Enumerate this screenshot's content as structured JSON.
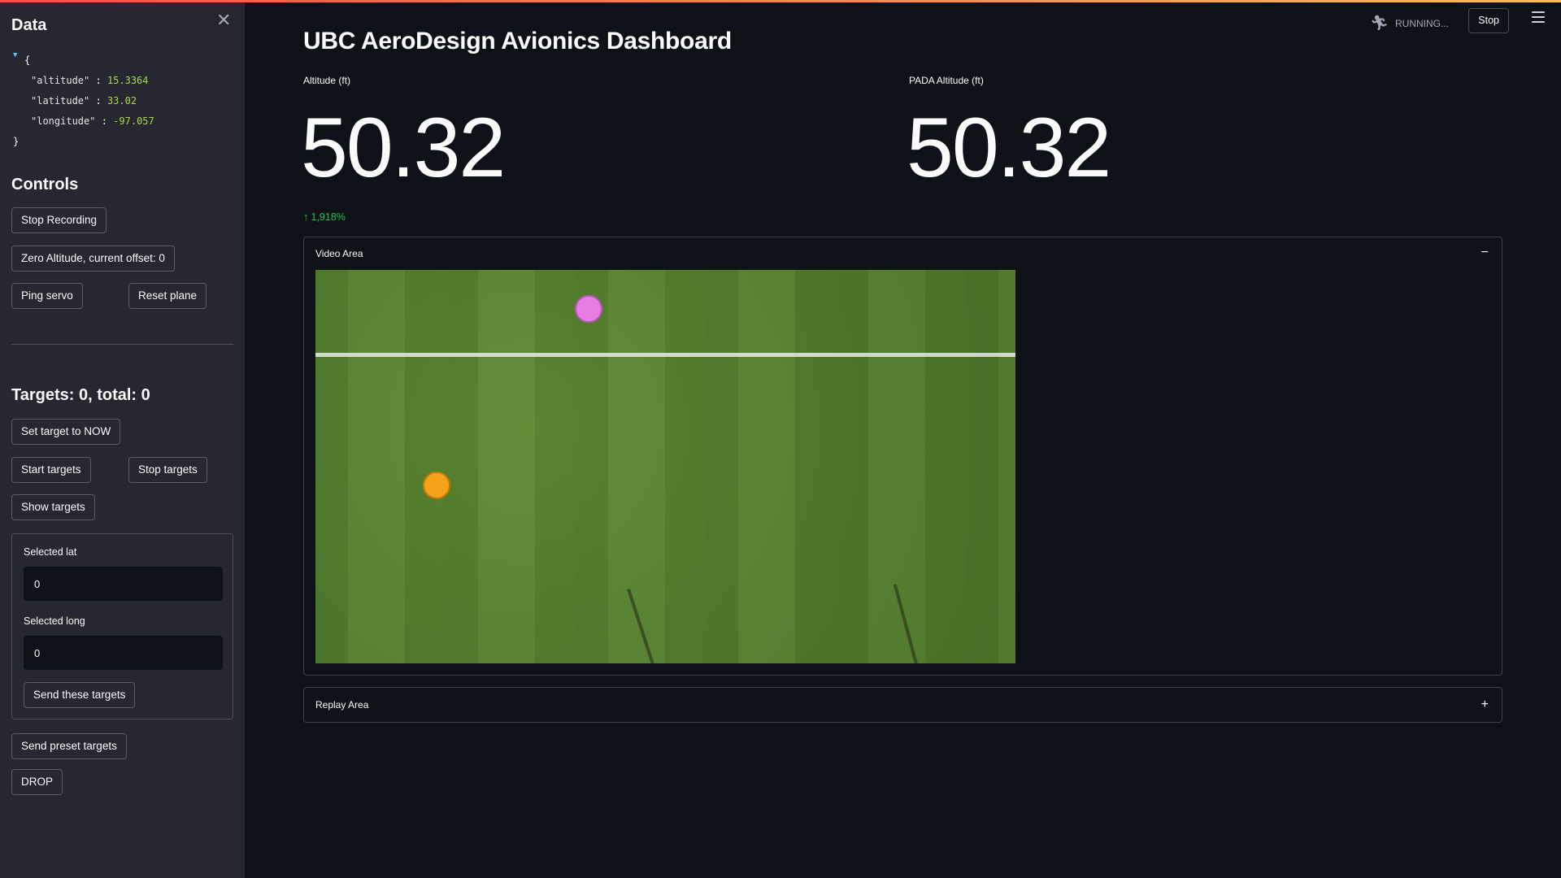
{
  "sidebar": {
    "title": "Data",
    "json": {
      "open": "{",
      "close": "}",
      "rows": [
        {
          "key": "\"altitude\"",
          "value": "15.3364"
        },
        {
          "key": "\"latitude\"",
          "value": "33.02"
        },
        {
          "key": "\"longitude\"",
          "value": "-97.057"
        }
      ]
    },
    "controls_heading": "Controls",
    "buttons": {
      "stop_recording": "Stop Recording",
      "zero_altitude": "Zero Altitude, current offset: 0",
      "ping_servo": "Ping servo",
      "reset_plane": "Reset plane",
      "set_target_now": "Set target to NOW",
      "start_targets": "Start targets",
      "stop_targets": "Stop targets",
      "show_targets": "Show targets",
      "send_these_targets": "Send these targets",
      "send_preset_targets": "Send preset targets",
      "drop": "DROP"
    },
    "targets_heading": "Targets: 0, total: 0",
    "form": {
      "lat_label": "Selected lat",
      "lat_value": "0",
      "long_label": "Selected long",
      "long_value": "0"
    }
  },
  "main": {
    "title": "UBC AeroDesign Avionics Dashboard",
    "status": "RUNNING...",
    "stop_label": "Stop",
    "metrics": [
      {
        "label": "Altitude (ft)",
        "value": "50.32",
        "delta": "1,918%"
      },
      {
        "label": "PADA Altitude (ft)",
        "value": "50.32"
      }
    ],
    "video_expander": {
      "label": "Video Area",
      "toggle": "−"
    },
    "replay_expander": {
      "label": "Replay Area",
      "toggle": "+"
    }
  },
  "colors": {
    "background": "#0e1117",
    "sidebar": "#262730",
    "delta_positive": "#21c354",
    "json_number": "#a8d94d",
    "target_pink": "#e67ee6",
    "target_orange": "#f4a21a"
  },
  "icons": [
    "close-icon",
    "running-icon",
    "hamburger-menu-icon",
    "arrow-up-icon",
    "collapse-icon",
    "expand-icon",
    "tree-caret-icon"
  ]
}
